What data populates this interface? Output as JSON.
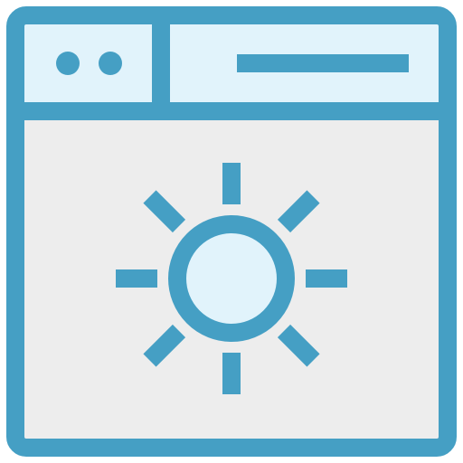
{
  "icon": {
    "name": "browser-window-brightness-icon",
    "parts": [
      "window-frame",
      "title-bar",
      "window-control-dots",
      "address-bar",
      "sun-icon"
    ]
  },
  "colors": {
    "stroke": "#459FC4",
    "titlebar_fill": "#E1F3FB",
    "content_fill": "#EDEDED",
    "sun_fill": "#E1F3FB",
    "background": "#FFFFFF"
  }
}
